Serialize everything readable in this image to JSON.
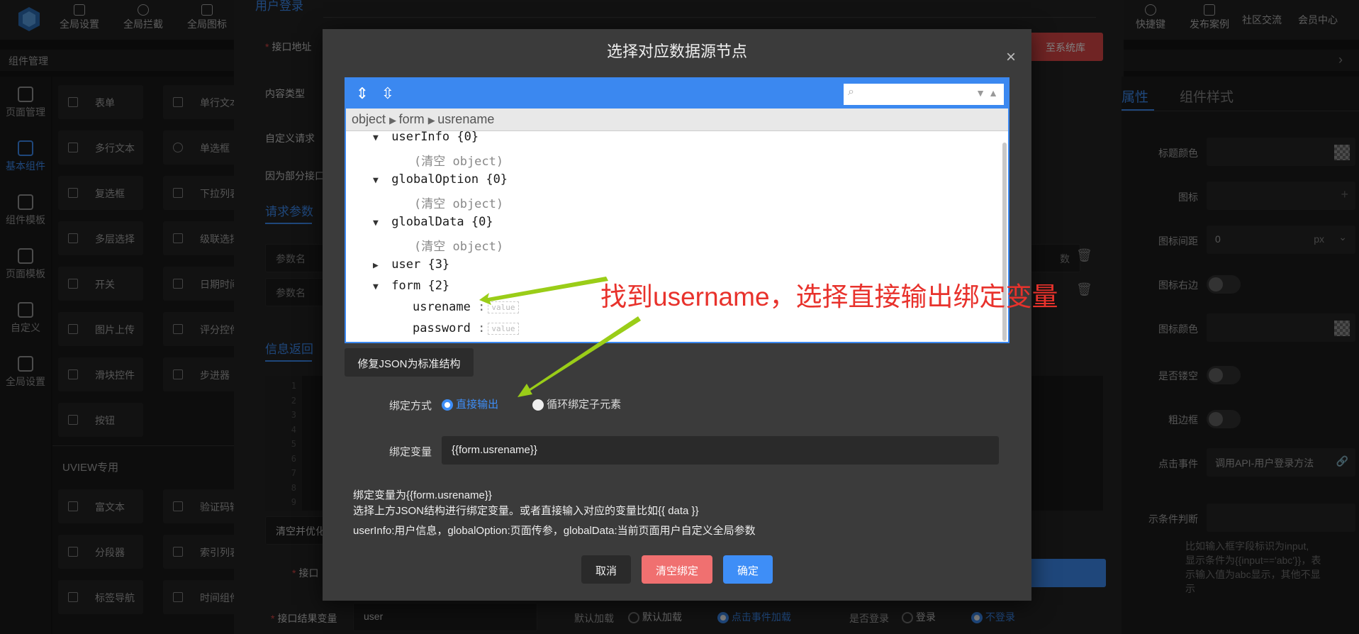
{
  "topbar": {
    "left_buttons": [
      "全局设置",
      "全局拦截",
      "全局图标"
    ],
    "right_buttons": [
      "快捷键",
      "发布案例"
    ],
    "links": [
      "社区交流",
      "会员中心"
    ]
  },
  "subbar": {
    "title": "组件管理"
  },
  "rail": {
    "items": [
      {
        "label": "页面管理",
        "icon": "pages-icon"
      },
      {
        "label": "基本组件",
        "icon": "puzzle-icon"
      },
      {
        "label": "组件模板",
        "icon": "template-icon"
      },
      {
        "label": "页面模板",
        "icon": "database-icon"
      },
      {
        "label": "自定义",
        "icon": "code-icon"
      },
      {
        "label": "全局设置",
        "icon": "gear-icon"
      }
    ],
    "active_index": 1
  },
  "components": {
    "col1": [
      "表单",
      "多行文本",
      "复选框",
      "多层选择",
      "开关",
      "图片上传",
      "滑块控件",
      "按钮"
    ],
    "col2": [
      "单行文本",
      "单选框",
      "下拉列表",
      "级联选择",
      "日期时间",
      "评分控件",
      "步进器"
    ],
    "section": "UVIEW专用",
    "uview_col1": [
      "富文本",
      "分段器",
      "标签导航"
    ],
    "uview_col2": [
      "验证码输入",
      "索引列表",
      "时间组件"
    ]
  },
  "center": {
    "top_tab": "用户登录",
    "api_label": "接口地址",
    "content_type_label": "内容类型",
    "custom_header_label": "自定义请求",
    "note_label": "因为部分接口",
    "request_params_tab": "请求参数",
    "param_name_placeholder": "参数名",
    "response_tab": "信息返回",
    "clear_btn": "清空并优化",
    "save_system_btn": "至系统库",
    "param_type_cell": "数",
    "api_label2": "接口",
    "result_var_label": "接口结果变量",
    "result_var_value": "user",
    "load_label": "默认加载",
    "load_opt1": "默认加载",
    "load_opt2": "点击事件加载",
    "login_label": "是否登录",
    "login_opt1": "登录",
    "login_opt2": "不登录",
    "code_lines": [
      "1",
      "2",
      "3",
      "4",
      "5",
      "6",
      "7",
      "8",
      "9"
    ]
  },
  "right_panel": {
    "tabs": [
      "属性",
      "组件样式"
    ],
    "rows": [
      {
        "label": "标题颜色",
        "type": "color"
      },
      {
        "label": "图标",
        "type": "input",
        "value": ""
      },
      {
        "label": "图标间距",
        "type": "input",
        "value": "0",
        "unit": "px"
      },
      {
        "label": "图标右边",
        "type": "toggle"
      },
      {
        "label": "图标颜色",
        "type": "color"
      },
      {
        "label": "是否镂空",
        "type": "toggle"
      },
      {
        "label": "粗边框",
        "type": "toggle"
      },
      {
        "label": "点击事件",
        "type": "input",
        "value": "调用API-用户登录方法"
      }
    ],
    "condition_label": "示条件判断",
    "help_text": [
      "比如输入框字段标识为input,",
      "显示条件为{{input=='abc'}}，表",
      "示输入值为abc显示，其他不显",
      "示"
    ]
  },
  "modal": {
    "title": "选择对应数据源节点",
    "close_label": "×",
    "breadcrumb": [
      "object",
      "form",
      "usrename"
    ],
    "tree": [
      {
        "key": "userInfo",
        "meta": "{0}",
        "open": true
      },
      {
        "key": "(清空 object)",
        "child": true
      },
      {
        "key": "globalOption",
        "meta": "{0}",
        "open": true
      },
      {
        "key": "(清空 object)",
        "child": true
      },
      {
        "key": "globalData",
        "meta": "{0}",
        "open": true
      },
      {
        "key": "(清空 object)",
        "child": true
      },
      {
        "key": "user",
        "meta": "{3}",
        "open": false
      },
      {
        "key": "form",
        "meta": "{2}",
        "open": true
      },
      {
        "key": "usrename",
        "leaf": true,
        "value": "value"
      },
      {
        "key": "password",
        "leaf": true,
        "value": "value"
      }
    ],
    "fix_json_btn": "修复JSON为标准结构",
    "bind_mode_label": "绑定方式",
    "bind_mode_opt1": "直接输出",
    "bind_mode_opt2": "循环绑定子元素",
    "bind_var_label": "绑定变量",
    "bind_var_value": "{{form.usrename}}",
    "info_line1": "绑定变量为{{form.usrename}}",
    "info_line2": "选择上方JSON结构进行绑定变量。或者直接输入对应的变量比如{{ data }}",
    "info_line3": "userInfo:用户信息，globalOption:页面传参，globalData:当前页面用户自定义全局参数",
    "cancel_btn": "取消",
    "clear_bind_btn": "清空绑定",
    "confirm_btn": "确定"
  },
  "annotation": {
    "text": "找到username，选择直接输出绑定变量",
    "color": "#e8322c",
    "arrow_color": "#9acd18"
  },
  "colors": {
    "accent": "#3e8ef7",
    "danger": "#e04848"
  }
}
